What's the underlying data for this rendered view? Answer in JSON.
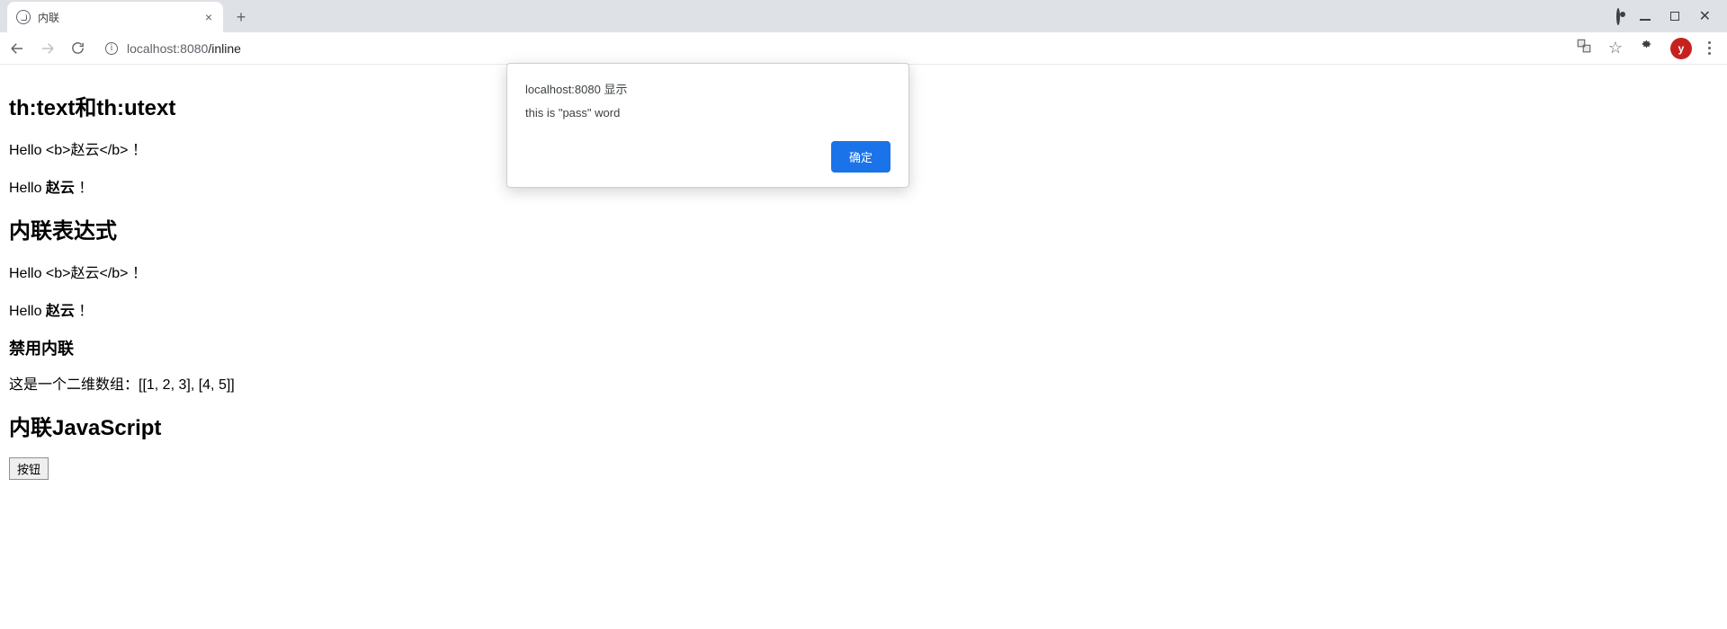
{
  "browser": {
    "tab": {
      "title": "内联"
    },
    "url": {
      "host": "localhost:",
      "port": "8080",
      "path": "/inline"
    },
    "avatar_letter": "y"
  },
  "dialog": {
    "title": "localhost:8080 显示",
    "message": "this is \"pass\" word",
    "ok_label": "确定"
  },
  "page": {
    "h1": "th:text和th:utext",
    "p1_text": "Hello <b>赵云</b> ！",
    "p2_prefix": "Hello ",
    "p2_bold": "赵云",
    "p2_suffix": " ！",
    "h2": "内联表达式",
    "p3_text": "Hello <b>赵云</b> ！",
    "p4_prefix": "Hello ",
    "p4_bold": "赵云",
    "p4_suffix": " ！",
    "h3": "禁用内联",
    "p5_text": "这是一个二维数组：[[1, 2, 3], [4, 5]]",
    "h4": "内联JavaScript",
    "button_label": "按钮"
  }
}
